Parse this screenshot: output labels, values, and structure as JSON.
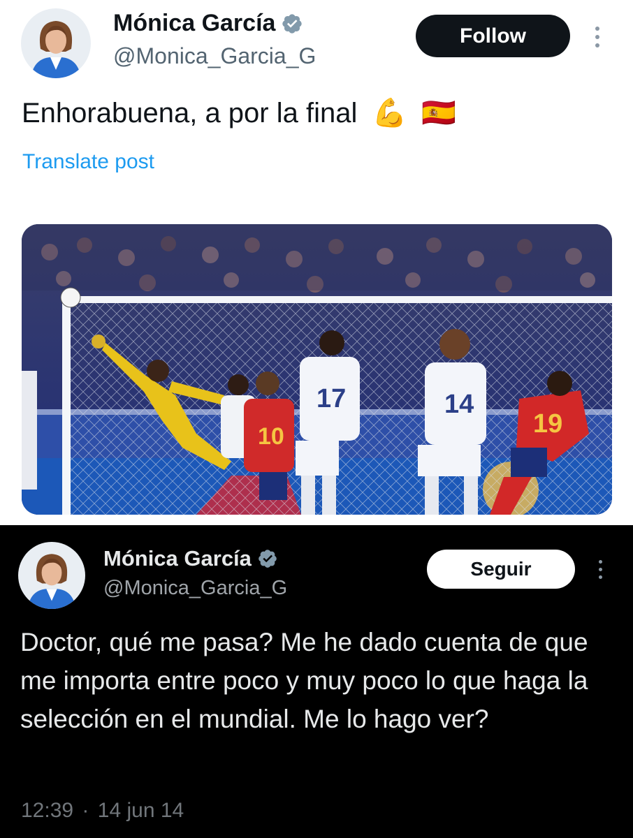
{
  "tweet_top": {
    "author_name": "Mónica García",
    "handle": "@Monica_Garcia_G",
    "follow_label": "Follow",
    "text": "Enhorabuena, a por la final",
    "emojis": [
      "💪",
      "🇪🇸"
    ],
    "translate_label": "Translate post",
    "media_icon": "football-photo",
    "jersey_numbers": [
      "17",
      "14",
      "10",
      "19"
    ]
  },
  "tweet_bottom": {
    "author_name": "Mónica García",
    "handle": "@Monica_Garcia_G",
    "follow_label": "Seguir",
    "text": "Doctor, qué me pasa? Me he dado cuenta de que me importa entre poco y muy poco lo que haga la selección en el mundial. Me lo hago ver?",
    "time": "12:39",
    "separator": "·",
    "date": "14 jun 14"
  },
  "colors": {
    "link": "#1d9bf0",
    "verified_gray": "#829aab",
    "muted": "#71767b",
    "dark_bg": "#000000",
    "light_bg": "#ffffff"
  },
  "icons": {
    "verified": "verified-badge-icon",
    "more": "more-options-icon"
  }
}
